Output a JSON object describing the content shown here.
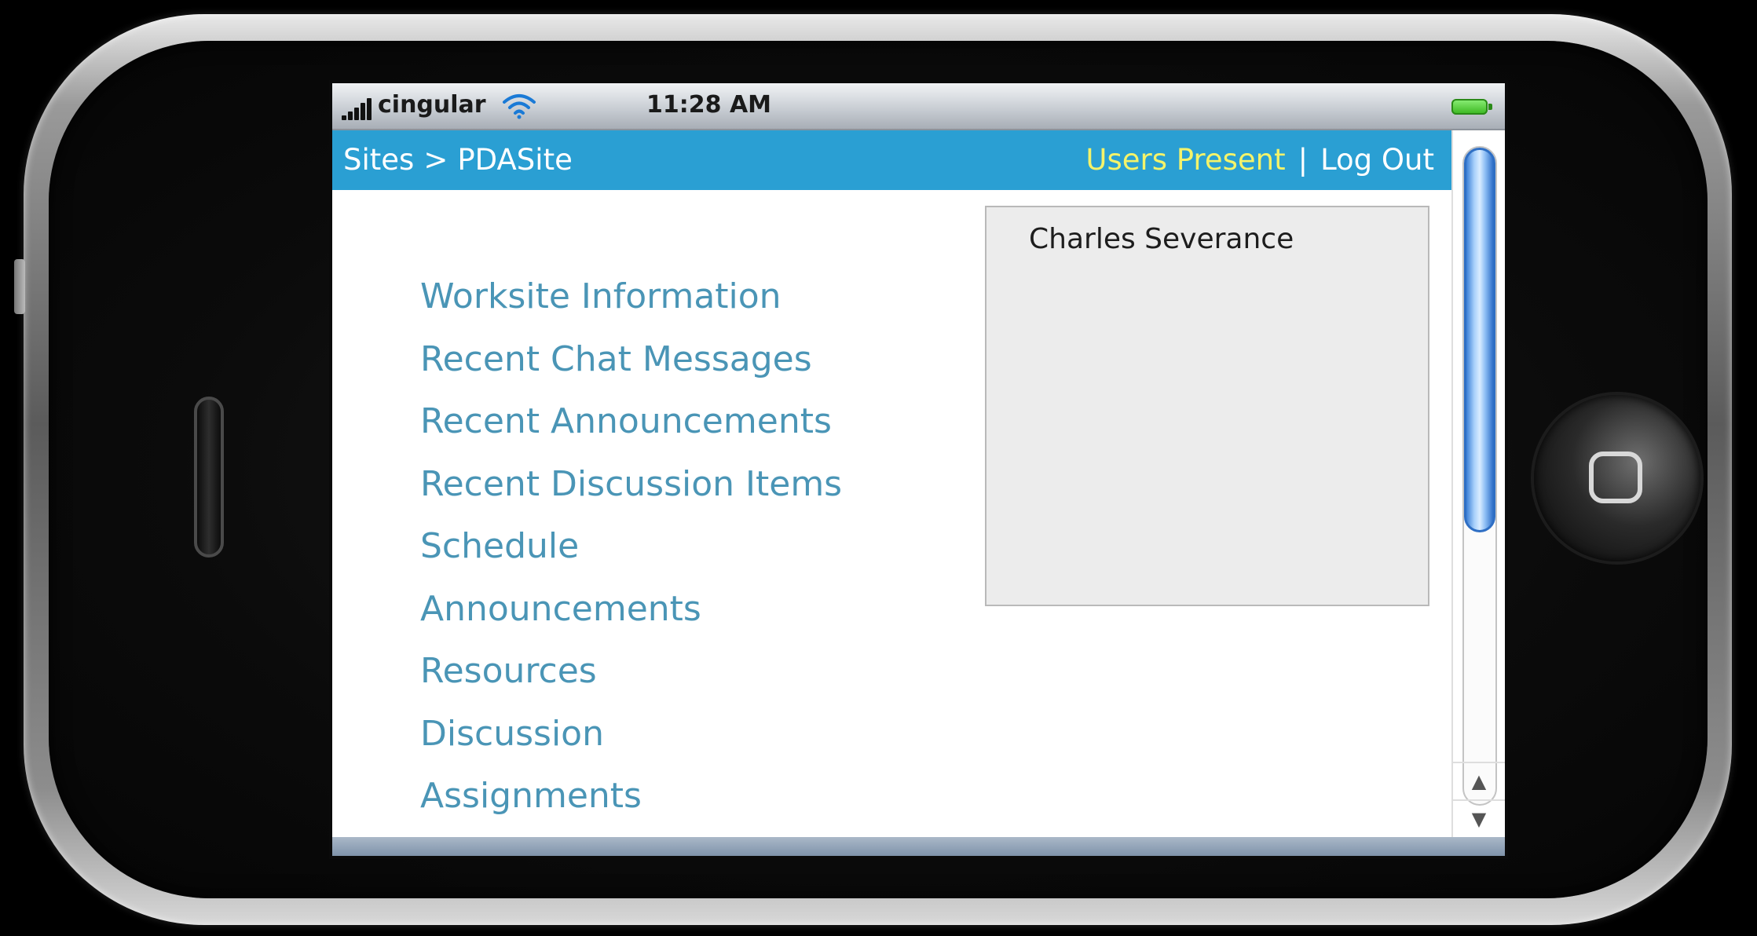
{
  "status_bar": {
    "carrier": "cingular",
    "time": "11:28 AM"
  },
  "nav": {
    "breadcrumb": [
      "Sites",
      "PDASite"
    ],
    "separator": ">",
    "users_present_label": "Users Present",
    "divider": "|",
    "logout_label": "Log Out"
  },
  "tools": [
    "Worksite Information",
    "Recent Chat Messages",
    "Recent Announcements",
    "Recent Discussion Items",
    "Schedule",
    "Announcements",
    "Resources",
    "Discussion",
    "Assignments"
  ],
  "presence": {
    "users": [
      "Charles Severance"
    ]
  },
  "colors": {
    "nav_background": "#2a9fd3",
    "link": "#4a95b6",
    "users_present": "#f4f36a"
  }
}
